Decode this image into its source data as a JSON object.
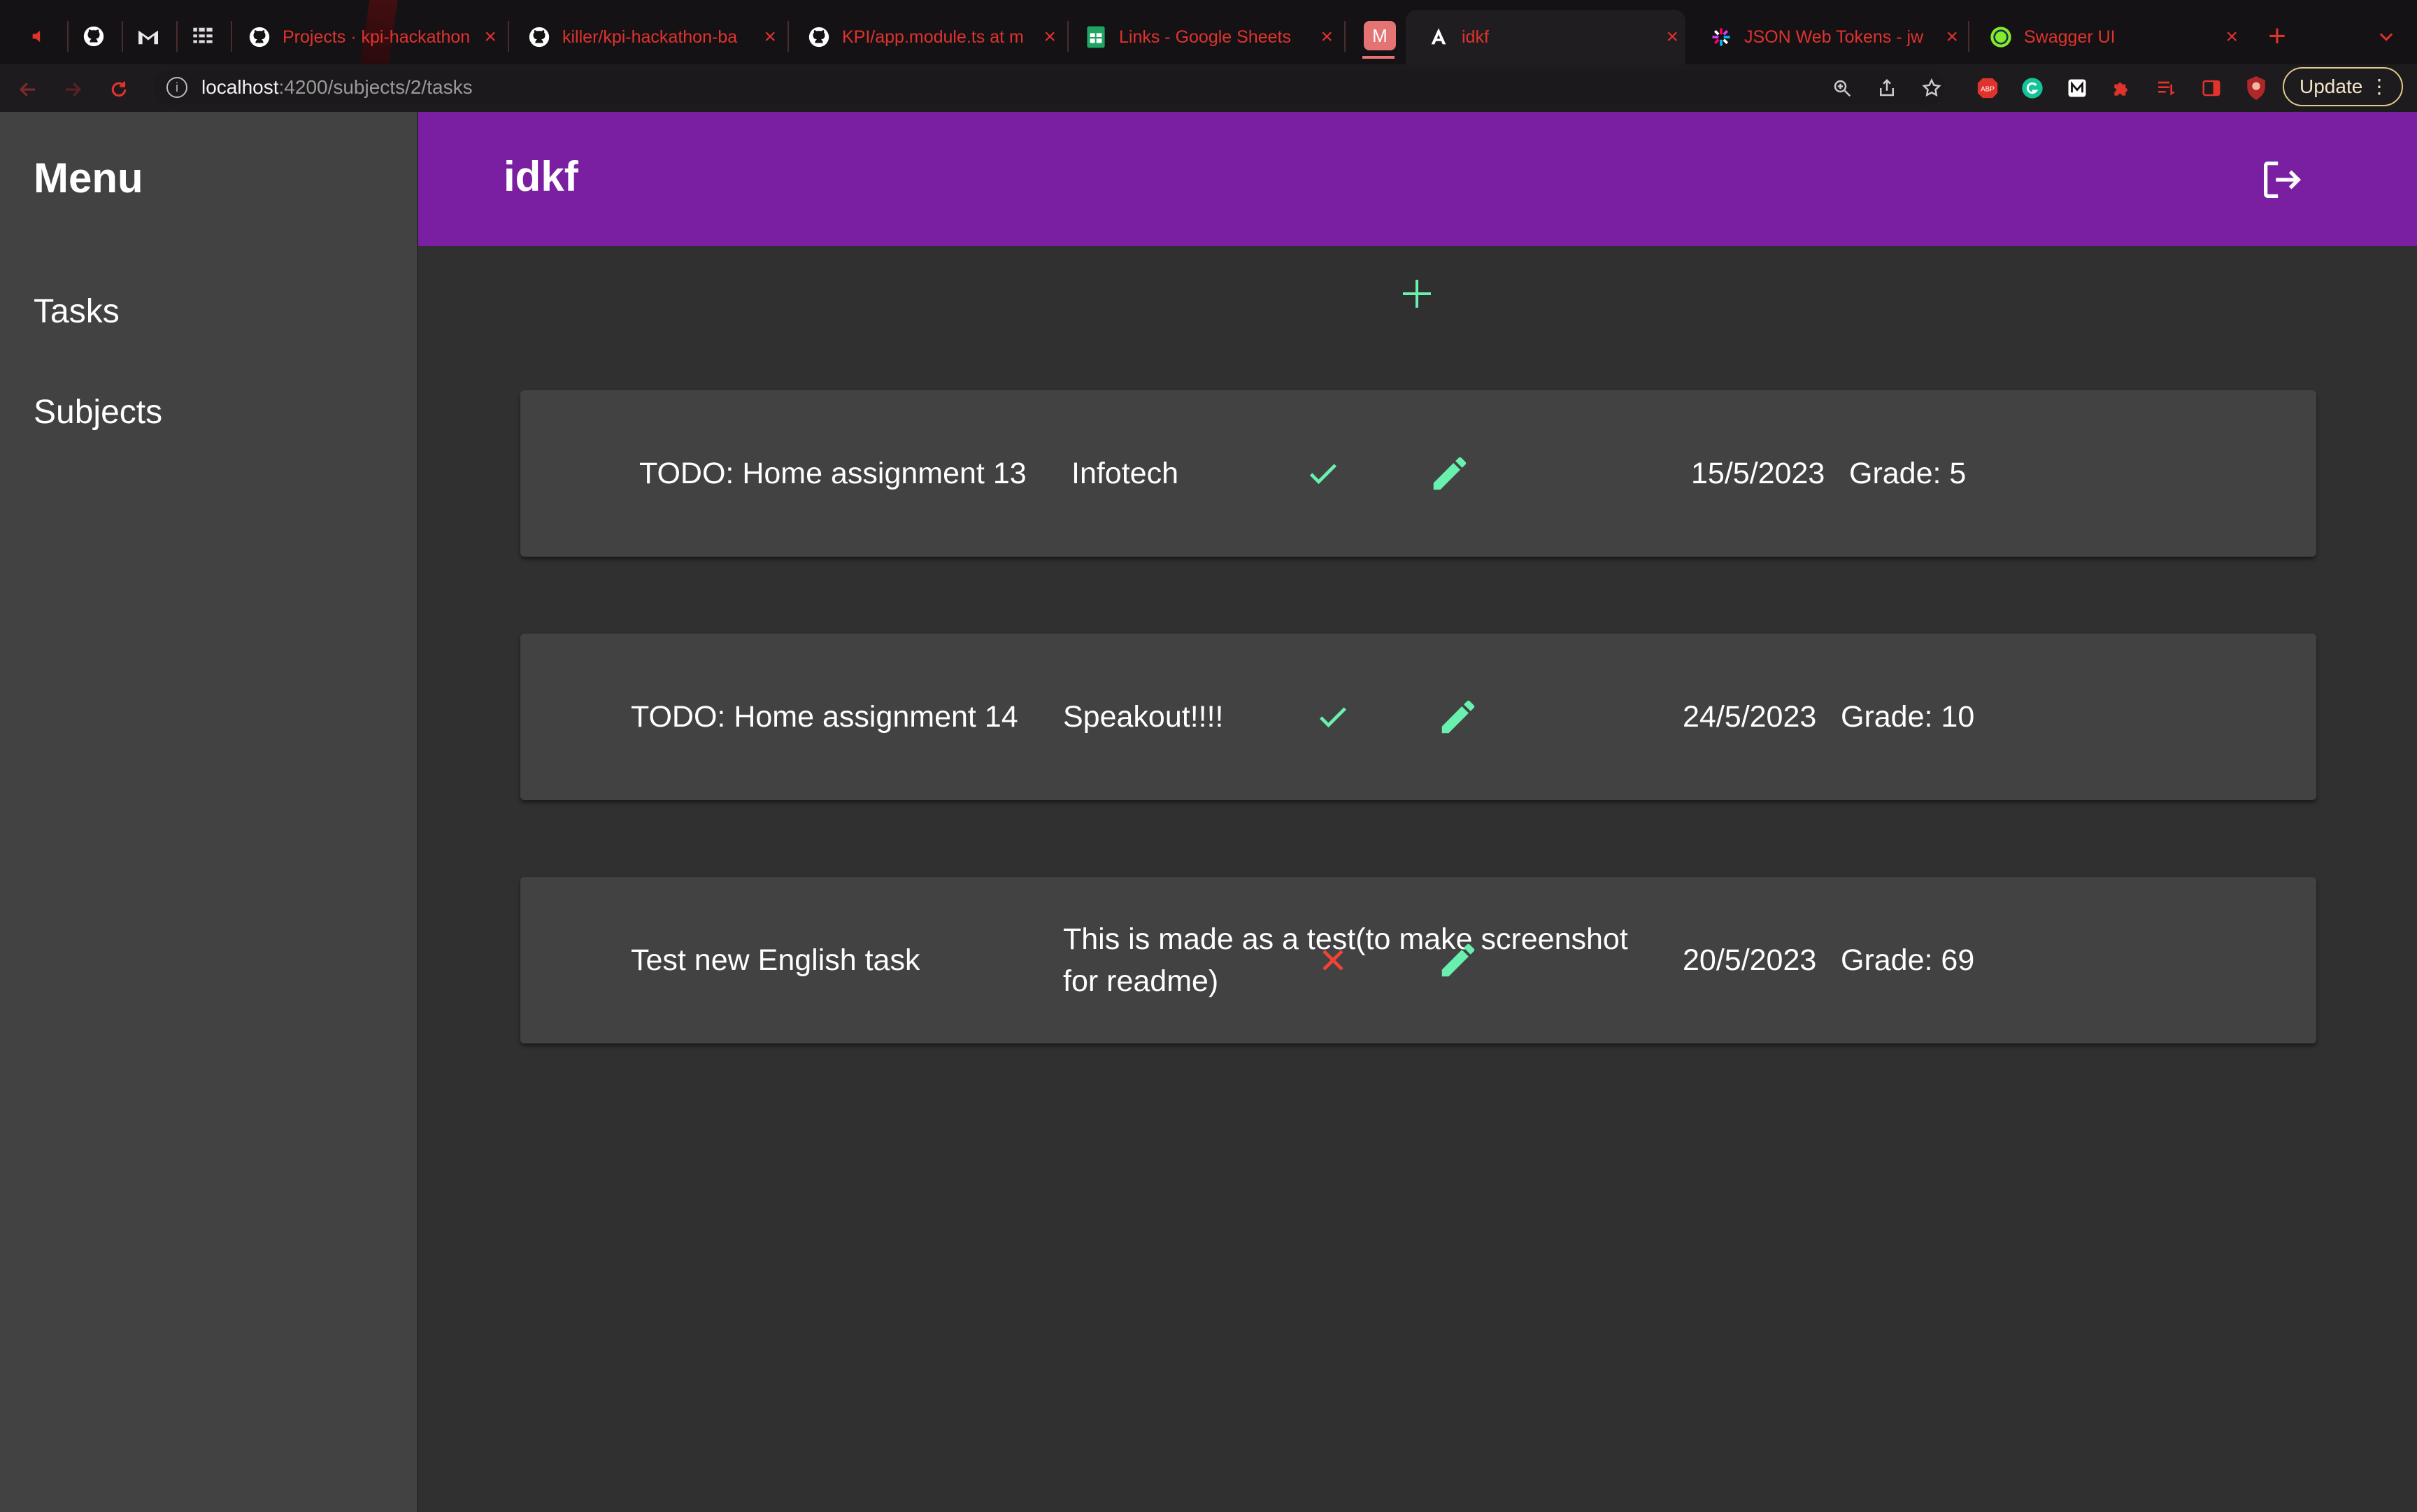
{
  "browser": {
    "tabs": [
      {
        "title": "Projects · kpi-hackathon",
        "icon": "github-icon"
      },
      {
        "title": "killer/kpi-hackathon-ba",
        "icon": "github-icon"
      },
      {
        "title": "KPI/app.module.ts at m",
        "icon": "github-icon"
      },
      {
        "title": "Links - Google Sheets",
        "icon": "sheets-icon"
      },
      {
        "title": "idkf",
        "icon": "angular-icon",
        "pinned_badge": "M"
      },
      {
        "title": "JSON Web Tokens - jw",
        "icon": "jwt-icon"
      },
      {
        "title": "Swagger UI",
        "icon": "swagger-icon"
      }
    ],
    "url_host": "localhost",
    "url_path": ":4200/subjects/2/tasks",
    "update_label": "Update",
    "extensions": [
      "zoom-icon",
      "share-icon",
      "star-icon",
      "adblock-icon",
      "grammarly-icon",
      "medium-icon",
      "puzzle-icon",
      "reading-list-icon",
      "side-panel-icon",
      "profile-icon"
    ]
  },
  "sidebar": {
    "title": "Menu",
    "items": [
      {
        "label": "Tasks"
      },
      {
        "label": "Subjects"
      }
    ]
  },
  "header": {
    "title": "idkf"
  },
  "tasks": [
    {
      "name": "TODO: Home assignment 13",
      "description": "Infotech",
      "date": "15/5/2023",
      "grade": "Grade: 5",
      "status": "done"
    },
    {
      "name": "TODO: Home assignment 14",
      "description": "Speakout!!!!",
      "date": "24/5/2023",
      "grade": "Grade: 10",
      "status": "done"
    },
    {
      "name": "Test new English task",
      "description_line1": "This is made as a test(to make screenshot",
      "description_line2": "for readme)",
      "date": "20/5/2023",
      "grade": "Grade: 69",
      "status": "not-done"
    }
  ],
  "colors": {
    "header": "#7b1fa2",
    "accent": "#69f0ae",
    "done": "#69f0ae",
    "not_done": "#f44336",
    "sidebar": "#424242",
    "background": "#303030",
    "card": "#424242"
  }
}
